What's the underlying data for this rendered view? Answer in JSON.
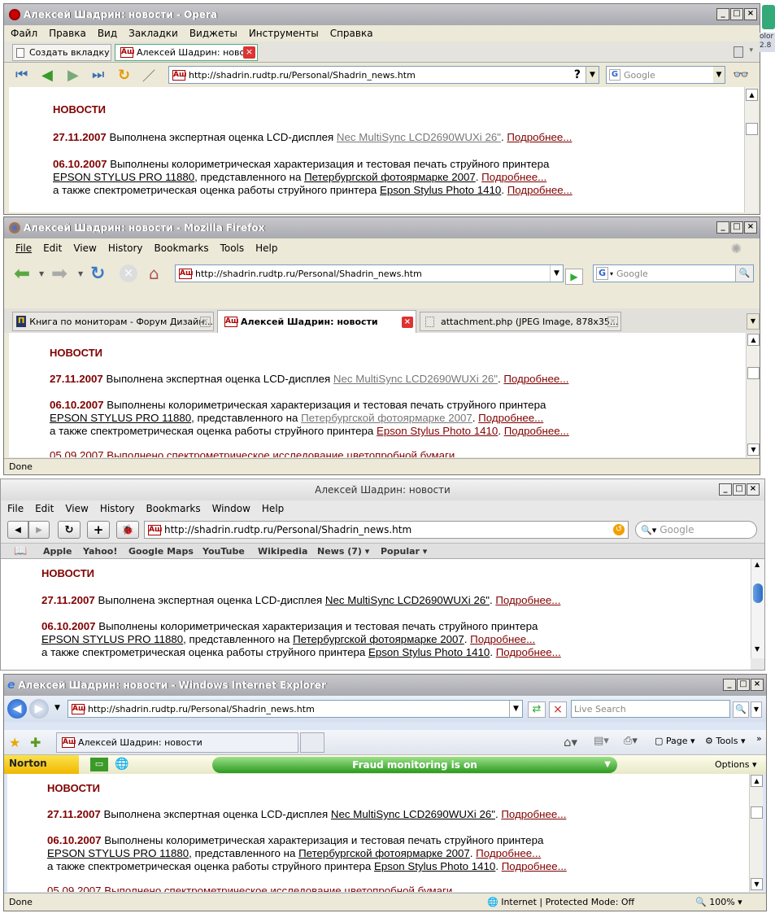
{
  "content": {
    "heading": "НОВОСТИ",
    "n1_date": "27.11.2007",
    "n1_text": " Выполнена экспертная оценка LCD-дисплея ",
    "n1_link": "Nec MultiSync LCD2690WUXi 26\"",
    "n1_more": "Подробнее...",
    "n2_date": "06.10.2007",
    "n2_text": " Выполнены колориметрическая характеризация и тестовая печать струйного принтера",
    "n2_l1": "EPSON STYLUS PRO 11880",
    "n2_mid": ", представленного на ",
    "n2_l2": "Петербургской фотоярмарке 2007",
    "n2_more": "Подробнее...",
    "n2_also": "а также спектрометрическая оценка работы струйного принтера ",
    "n2_l3": "Epson Stylus Photo 1410",
    "n2_more2": "Подробнее...",
    "n3_partial": "05.09.2007 Выполнено спектрометрическое исследование цветопробной бумаги"
  },
  "desktop": {
    "text": "olor 2.8"
  },
  "opera": {
    "title": "Алексей Шадрин: новости - Opera",
    "menu": [
      "Файл",
      "Правка",
      "Вид",
      "Закладки",
      "Виджеты",
      "Инструменты",
      "Справка"
    ],
    "new_tab": "Создать вкладку",
    "tab": "Алексей Шадрин: ново...",
    "url": "http://shadrin.rudtp.ru/Personal/Shadrin_news.htm",
    "search": "Google"
  },
  "firefox": {
    "title": "Алексей Шадрин: новости - Mozilla Firefox",
    "menu": [
      "File",
      "Edit",
      "View",
      "History",
      "Bookmarks",
      "Tools",
      "Help"
    ],
    "url": "http://shadrin.rudtp.ru/Personal/Shadrin_news.htm",
    "search": "Google",
    "tabs": [
      "Книга по мониторам - Форум Дизайн...",
      "Алексей Шадрин: новости",
      "attachment.php (JPEG Image, 878x35..."
    ],
    "status": "Done"
  },
  "safari": {
    "title": "Алексей Шадрин: новости",
    "menu": [
      "File",
      "Edit",
      "View",
      "History",
      "Bookmarks",
      "Window",
      "Help"
    ],
    "url": "http://shadrin.rudtp.ru/Personal/Shadrin_news.htm",
    "search": "Google",
    "bookmarks": [
      "Apple",
      "Yahoo!",
      "Google Maps",
      "YouTube",
      "Wikipedia",
      "News (7)",
      "Popular"
    ]
  },
  "ie": {
    "title": "Алексей Шадрин: новости - Windows Internet Explorer",
    "url": "http://shadrin.rudtp.ru/Personal/Shadrin_news.htm",
    "search": "Live Search",
    "tab": "Алексей Шадрин: новости",
    "page": "Page",
    "tools": "Tools",
    "norton": "Norton",
    "fraud": "Fraud monitoring is on",
    "options": "Options",
    "status": "Done",
    "zone": "Internet | Protected Mode: Off",
    "zoom": "100%"
  }
}
